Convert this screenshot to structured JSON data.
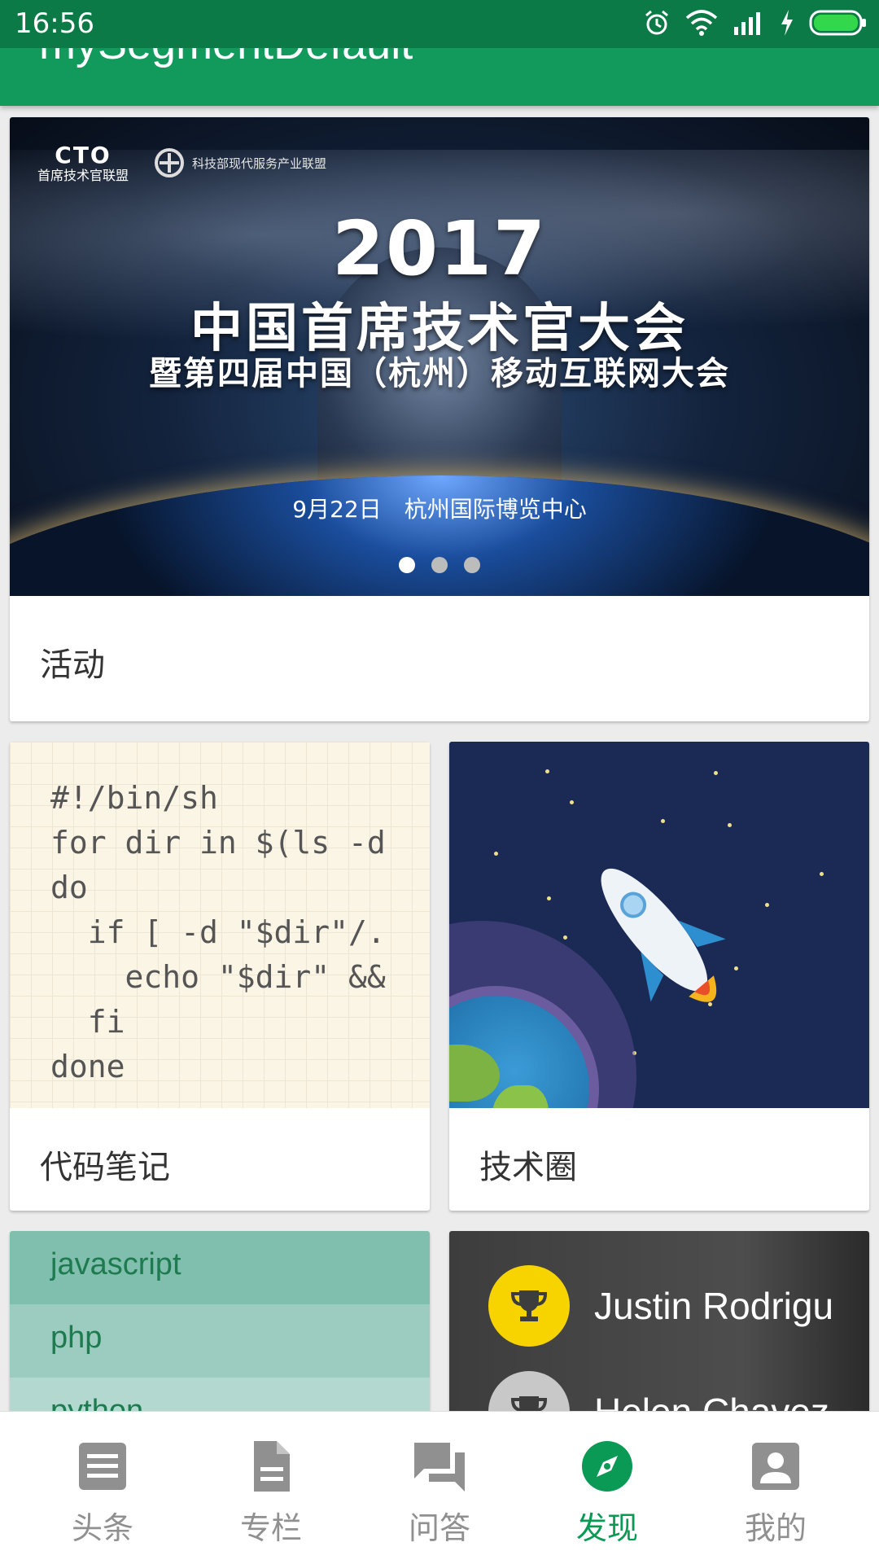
{
  "status_bar": {
    "time": "16:56",
    "icons": [
      "alarm-icon",
      "wifi-icon",
      "signal-icon",
      "charging-icon",
      "battery-icon"
    ]
  },
  "app_bar": {
    "title": "mySegmentDefault"
  },
  "banner": {
    "logo_left_mark": "CTO",
    "logo_left_text": "首席技术官联盟",
    "logo_right_text": "科技部现代服务产业联盟",
    "year": "2017",
    "headline": "中国首席技术官大会",
    "subline": "暨第四届中国（杭州）移动互联网大会",
    "event_info": "9月22日　杭州国际博览中心",
    "page_count": 3,
    "active_page": 1
  },
  "cards": {
    "activity": {
      "label": "活动"
    },
    "code_notes": {
      "label": "代码笔记",
      "code": "#!/bin/sh\nfor dir in $(ls -d\ndo\n  if [ -d \"$dir\"/.\n    echo \"$dir\" &&\n  fi\ndone"
    },
    "tech_circle": {
      "label": "技术圈"
    },
    "tags": {
      "items": [
        "javascript",
        "php",
        "python"
      ]
    },
    "ranking": {
      "names": [
        "Justin Rodrigu",
        "Helen Chavez"
      ]
    }
  },
  "bottom_nav": {
    "items": [
      {
        "label": "头条",
        "icon": "list-icon"
      },
      {
        "label": "专栏",
        "icon": "document-icon"
      },
      {
        "label": "问答",
        "icon": "chat-icon"
      },
      {
        "label": "发现",
        "icon": "compass-icon"
      },
      {
        "label": "我的",
        "icon": "person-icon"
      }
    ],
    "active_index": 3
  },
  "colors": {
    "status_bar": "#0c7a46",
    "app_bar": "#129a5c",
    "accent": "#0b9a55",
    "inactive": "#909090",
    "trophy_gold": "#f7d400"
  }
}
